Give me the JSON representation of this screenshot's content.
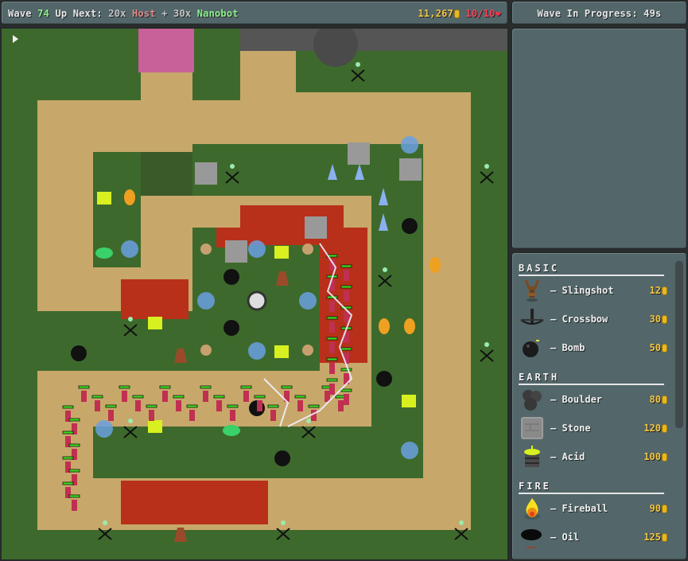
{
  "topbar": {
    "wave_label": "Wave",
    "wave_number": "74",
    "up_next_label": "Up Next:",
    "next_enemies": [
      {
        "count": "20x",
        "name": "Host",
        "color": "#e38a8a"
      },
      {
        "count": "30x",
        "name": "Nanobot",
        "color": "#8ff08f"
      }
    ],
    "plus": "+",
    "gold": "11,267",
    "lives": "10/10",
    "gold_icon": "coin-icon",
    "lives_icon": "heart-icon"
  },
  "status": {
    "text": "Wave In Progress: 49s"
  },
  "map": {
    "play_icon": "play-icon"
  },
  "shop": {
    "sections": [
      {
        "title": "BASIC",
        "items": [
          {
            "name": "Slingshot",
            "price": "12",
            "icon": "slingshot-icon"
          },
          {
            "name": "Crossbow",
            "price": "30",
            "icon": "crossbow-icon"
          },
          {
            "name": "Bomb",
            "price": "50",
            "icon": "bomb-icon"
          }
        ]
      },
      {
        "title": "EARTH",
        "items": [
          {
            "name": "Boulder",
            "price": "80",
            "icon": "boulder-icon"
          },
          {
            "name": "Stone",
            "price": "120",
            "icon": "stone-icon"
          },
          {
            "name": "Acid",
            "price": "100",
            "icon": "acid-icon"
          }
        ]
      },
      {
        "title": "FIRE",
        "items": [
          {
            "name": "Fireball",
            "price": "90",
            "icon": "fireball-icon"
          },
          {
            "name": "Oil",
            "price": "125",
            "icon": "oil-icon"
          }
        ]
      }
    ]
  },
  "colors": {
    "panel": "#536669",
    "gold": "#f4c542",
    "lives": "#ff4055",
    "wave_number": "#8ff08f"
  }
}
